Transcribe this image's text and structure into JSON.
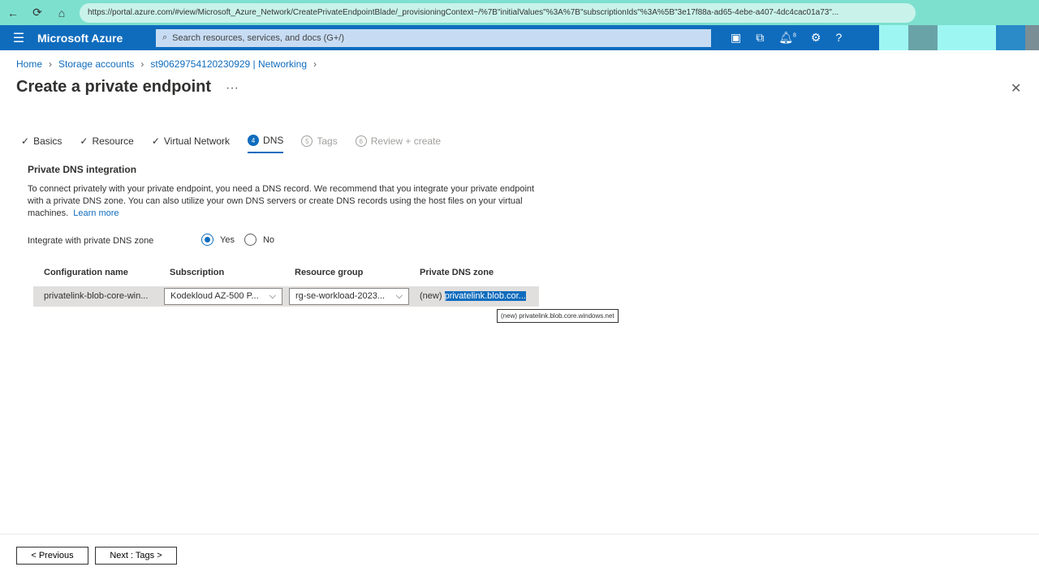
{
  "browser": {
    "url": "https://portal.azure.com/#view/Microsoft_Azure_Network/CreatePrivateEndpointBlade/_provisioningContext~/%7B\"initialValues\"%3A%7B\"subscriptionIds\"%3A%5B\"3e17f88a-ad65-4ebe-a407-4dc4cac01a73\"..."
  },
  "header": {
    "brand": "Microsoft Azure",
    "search_placeholder": "Search resources, services, and docs (G+/)",
    "notification_count": "8"
  },
  "breadcrumb": [
    "Home",
    "Storage accounts",
    "st90629754120230929 | Networking"
  ],
  "title": "Create a private endpoint",
  "tabs": [
    {
      "label": "Basics"
    },
    {
      "label": "Resource"
    },
    {
      "label": "Virtual Network"
    },
    {
      "num": "4",
      "label": "DNS"
    },
    {
      "num": "5",
      "label": "Tags"
    },
    {
      "num": "6",
      "label": "Review + create"
    }
  ],
  "section": {
    "title": "Private DNS integration",
    "desc": "To connect privately with your private endpoint, you need a DNS record. We recommend that you integrate your private endpoint with a private DNS zone. You can also utilize your own DNS servers or create DNS records using the host files on your virtual machines.",
    "learn_more": "Learn more"
  },
  "integrate": {
    "label": "Integrate with private DNS zone",
    "yes": "Yes",
    "no": "No",
    "selected": "Yes"
  },
  "table": {
    "headers": [
      "Configuration name",
      "Subscription",
      "Resource group",
      "Private DNS zone"
    ],
    "row": {
      "config": "privatelink-blob-core-win...",
      "subscription": "Kodekloud AZ-500 P...",
      "resource_group": "rg-se-workload-2023...",
      "zone_prefix": "(new)",
      "zone": "privatelink.blob.cor...",
      "tooltip": "(new) privatelink.blob.core.windows.net"
    }
  },
  "footer": {
    "previous": "< Previous",
    "next": "Next : Tags >"
  }
}
